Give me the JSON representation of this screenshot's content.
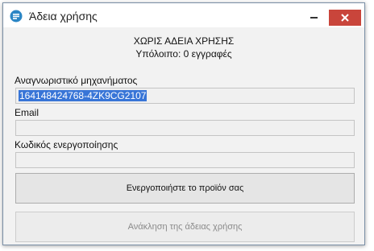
{
  "window": {
    "title": "Άδεια χρήσης"
  },
  "status": {
    "license_state": "ΧΩΡΙΣ ΑΔΕΙΑ ΧΡΗΣΗΣ",
    "remaining": "Υπόλοιπο: 0 εγγραφές"
  },
  "machine_id": {
    "label": "Αναγνωριστικό μηχανήματος",
    "value": "164148424768-4ZK9CG2107"
  },
  "email": {
    "label": "Email",
    "value": ""
  },
  "activation_code": {
    "label": "Κωδικός ενεργοποίησης",
    "value": ""
  },
  "buttons": {
    "activate_label": "Ενεργοποιήστε το προϊόν σας",
    "revoke_label": "Ανάκληση της άδειας χρήσης"
  },
  "colors": {
    "close_button": "#c9453b",
    "selection": "#3875d7",
    "app_icon": "#2b86c5"
  },
  "icons": {
    "app": "app-icon",
    "minimize": "minimize-icon",
    "close": "close-icon"
  }
}
